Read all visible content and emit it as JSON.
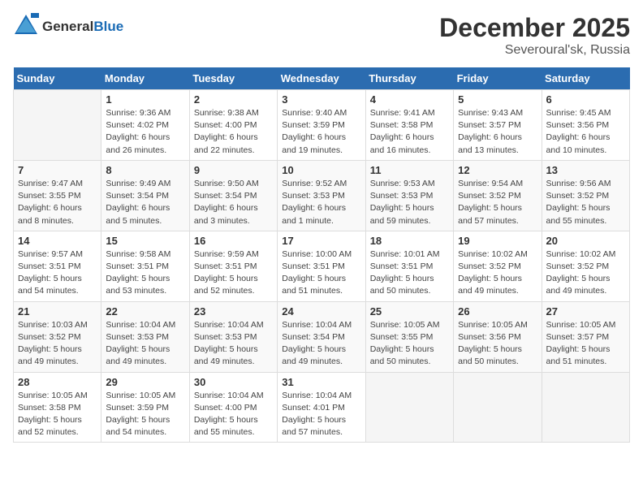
{
  "header": {
    "logo_general": "General",
    "logo_blue": "Blue",
    "month": "December 2025",
    "location": "Severoural'sk, Russia"
  },
  "weekdays": [
    "Sunday",
    "Monday",
    "Tuesday",
    "Wednesday",
    "Thursday",
    "Friday",
    "Saturday"
  ],
  "weeks": [
    [
      {
        "day": "",
        "info": ""
      },
      {
        "day": "1",
        "info": "Sunrise: 9:36 AM\nSunset: 4:02 PM\nDaylight: 6 hours\nand 26 minutes."
      },
      {
        "day": "2",
        "info": "Sunrise: 9:38 AM\nSunset: 4:00 PM\nDaylight: 6 hours\nand 22 minutes."
      },
      {
        "day": "3",
        "info": "Sunrise: 9:40 AM\nSunset: 3:59 PM\nDaylight: 6 hours\nand 19 minutes."
      },
      {
        "day": "4",
        "info": "Sunrise: 9:41 AM\nSunset: 3:58 PM\nDaylight: 6 hours\nand 16 minutes."
      },
      {
        "day": "5",
        "info": "Sunrise: 9:43 AM\nSunset: 3:57 PM\nDaylight: 6 hours\nand 13 minutes."
      },
      {
        "day": "6",
        "info": "Sunrise: 9:45 AM\nSunset: 3:56 PM\nDaylight: 6 hours\nand 10 minutes."
      }
    ],
    [
      {
        "day": "7",
        "info": "Sunrise: 9:47 AM\nSunset: 3:55 PM\nDaylight: 6 hours\nand 8 minutes."
      },
      {
        "day": "8",
        "info": "Sunrise: 9:49 AM\nSunset: 3:54 PM\nDaylight: 6 hours\nand 5 minutes."
      },
      {
        "day": "9",
        "info": "Sunrise: 9:50 AM\nSunset: 3:54 PM\nDaylight: 6 hours\nand 3 minutes."
      },
      {
        "day": "10",
        "info": "Sunrise: 9:52 AM\nSunset: 3:53 PM\nDaylight: 6 hours\nand 1 minute."
      },
      {
        "day": "11",
        "info": "Sunrise: 9:53 AM\nSunset: 3:53 PM\nDaylight: 5 hours\nand 59 minutes."
      },
      {
        "day": "12",
        "info": "Sunrise: 9:54 AM\nSunset: 3:52 PM\nDaylight: 5 hours\nand 57 minutes."
      },
      {
        "day": "13",
        "info": "Sunrise: 9:56 AM\nSunset: 3:52 PM\nDaylight: 5 hours\nand 55 minutes."
      }
    ],
    [
      {
        "day": "14",
        "info": "Sunrise: 9:57 AM\nSunset: 3:51 PM\nDaylight: 5 hours\nand 54 minutes."
      },
      {
        "day": "15",
        "info": "Sunrise: 9:58 AM\nSunset: 3:51 PM\nDaylight: 5 hours\nand 53 minutes."
      },
      {
        "day": "16",
        "info": "Sunrise: 9:59 AM\nSunset: 3:51 PM\nDaylight: 5 hours\nand 52 minutes."
      },
      {
        "day": "17",
        "info": "Sunrise: 10:00 AM\nSunset: 3:51 PM\nDaylight: 5 hours\nand 51 minutes."
      },
      {
        "day": "18",
        "info": "Sunrise: 10:01 AM\nSunset: 3:51 PM\nDaylight: 5 hours\nand 50 minutes."
      },
      {
        "day": "19",
        "info": "Sunrise: 10:02 AM\nSunset: 3:52 PM\nDaylight: 5 hours\nand 49 minutes."
      },
      {
        "day": "20",
        "info": "Sunrise: 10:02 AM\nSunset: 3:52 PM\nDaylight: 5 hours\nand 49 minutes."
      }
    ],
    [
      {
        "day": "21",
        "info": "Sunrise: 10:03 AM\nSunset: 3:52 PM\nDaylight: 5 hours\nand 49 minutes."
      },
      {
        "day": "22",
        "info": "Sunrise: 10:04 AM\nSunset: 3:53 PM\nDaylight: 5 hours\nand 49 minutes."
      },
      {
        "day": "23",
        "info": "Sunrise: 10:04 AM\nSunset: 3:53 PM\nDaylight: 5 hours\nand 49 minutes."
      },
      {
        "day": "24",
        "info": "Sunrise: 10:04 AM\nSunset: 3:54 PM\nDaylight: 5 hours\nand 49 minutes."
      },
      {
        "day": "25",
        "info": "Sunrise: 10:05 AM\nSunset: 3:55 PM\nDaylight: 5 hours\nand 50 minutes."
      },
      {
        "day": "26",
        "info": "Sunrise: 10:05 AM\nSunset: 3:56 PM\nDaylight: 5 hours\nand 50 minutes."
      },
      {
        "day": "27",
        "info": "Sunrise: 10:05 AM\nSunset: 3:57 PM\nDaylight: 5 hours\nand 51 minutes."
      }
    ],
    [
      {
        "day": "28",
        "info": "Sunrise: 10:05 AM\nSunset: 3:58 PM\nDaylight: 5 hours\nand 52 minutes."
      },
      {
        "day": "29",
        "info": "Sunrise: 10:05 AM\nSunset: 3:59 PM\nDaylight: 5 hours\nand 54 minutes."
      },
      {
        "day": "30",
        "info": "Sunrise: 10:04 AM\nSunset: 4:00 PM\nDaylight: 5 hours\nand 55 minutes."
      },
      {
        "day": "31",
        "info": "Sunrise: 10:04 AM\nSunset: 4:01 PM\nDaylight: 5 hours\nand 57 minutes."
      },
      {
        "day": "",
        "info": ""
      },
      {
        "day": "",
        "info": ""
      },
      {
        "day": "",
        "info": ""
      }
    ]
  ]
}
